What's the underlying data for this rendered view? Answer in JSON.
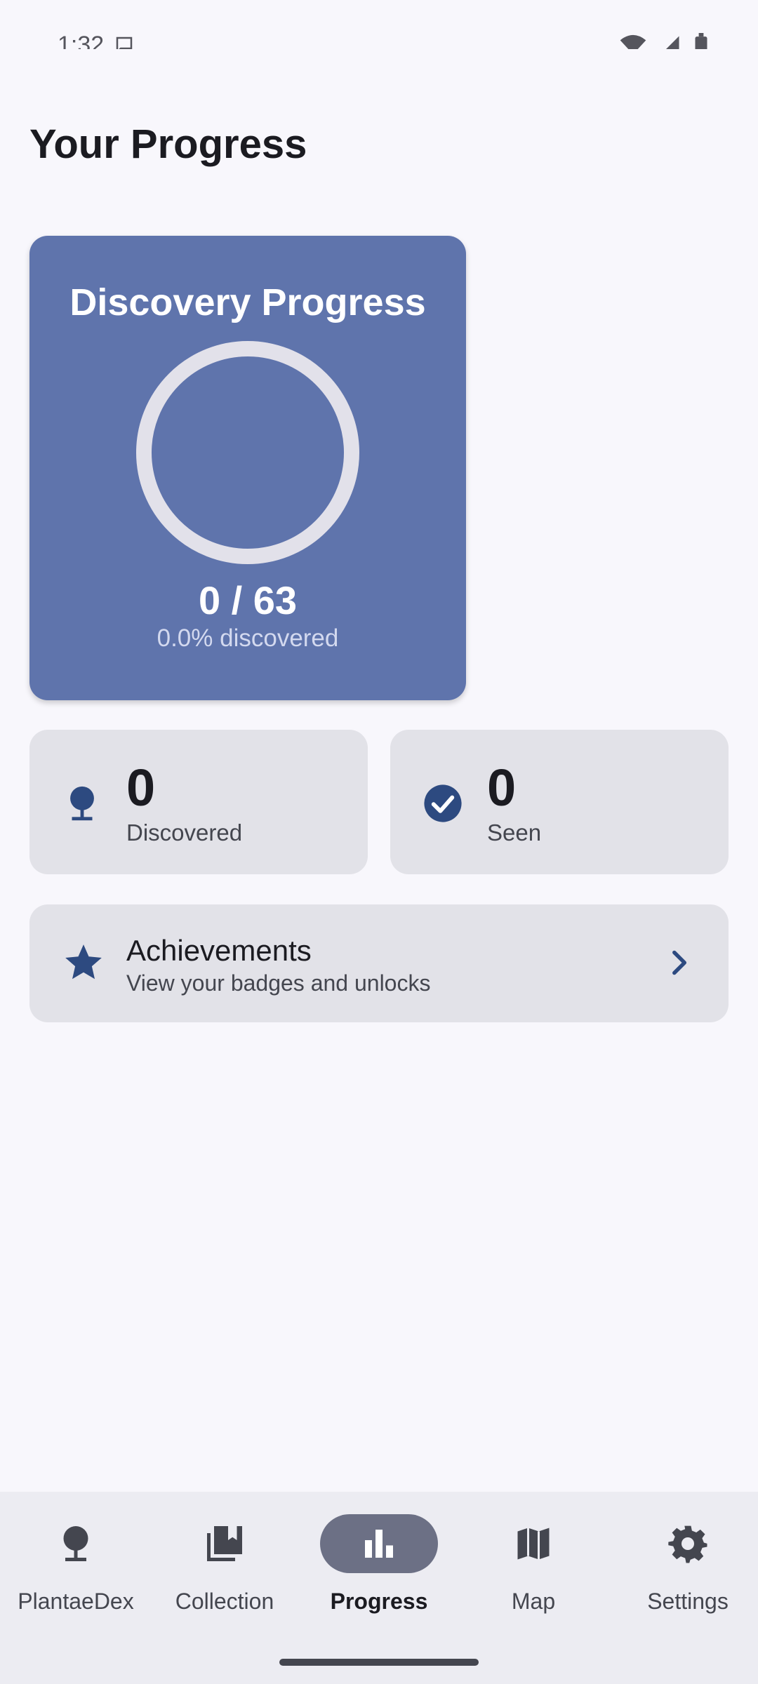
{
  "status_bar": {
    "time": "1:32",
    "icons": [
      "notification-icon",
      "wifi-icon",
      "signal-icon",
      "battery-icon"
    ]
  },
  "page": {
    "title": "Your Progress"
  },
  "progress_card": {
    "title": "Discovery Progress",
    "count": "0 / 63",
    "percent_text": "0.0% discovered",
    "progress_fraction": 0.0
  },
  "stats": {
    "discovered": {
      "value": "0",
      "label": "Discovered",
      "icon": "tree-icon"
    },
    "seen": {
      "value": "0",
      "label": "Seen",
      "icon": "check-circle-icon"
    }
  },
  "achievements": {
    "title": "Achievements",
    "subtitle": "View your badges and unlocks",
    "icon": "star-icon"
  },
  "bottom_nav": {
    "items": [
      {
        "label": "PlantaeDex",
        "icon": "tree-icon",
        "active": false
      },
      {
        "label": "Collection",
        "icon": "collection-icon",
        "active": false
      },
      {
        "label": "Progress",
        "icon": "bar-chart-icon",
        "active": true
      },
      {
        "label": "Map",
        "icon": "map-icon",
        "active": false
      },
      {
        "label": "Settings",
        "icon": "gear-icon",
        "active": false
      }
    ]
  },
  "colors": {
    "background": "#f8f7fc",
    "card_primary": "#5f74ac",
    "surface_variant": "#e2e2e8",
    "accent": "#2d4a80",
    "ring_track": "#e2e1ea",
    "nav_active_pill": "#6c7085"
  }
}
